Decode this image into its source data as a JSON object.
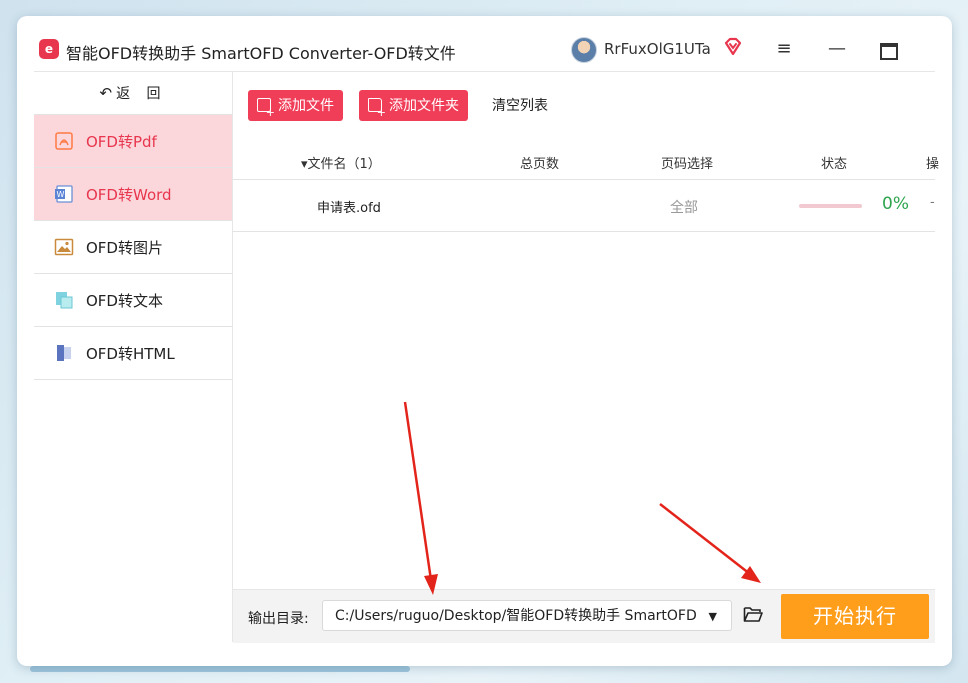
{
  "window": {
    "title": "智能OFD转换助手 SmartOFD Converter-OFD转文件",
    "username": "RrFuxOlG1UTa",
    "logo_text": "e"
  },
  "sidebar": {
    "back_label": "返 回",
    "items": [
      {
        "label": "OFD转Pdf",
        "icon": "pdf-icon",
        "active": true
      },
      {
        "label": "OFD转Word",
        "icon": "word-icon",
        "active": true
      },
      {
        "label": "OFD转图片",
        "icon": "image-icon",
        "active": false
      },
      {
        "label": "OFD转文本",
        "icon": "text-icon",
        "active": false
      },
      {
        "label": "OFD转HTML",
        "icon": "html-icon",
        "active": false
      }
    ]
  },
  "toolbar": {
    "add_file": "添加文件",
    "add_folder": "添加文件夹",
    "clear_list": "清空列表"
  },
  "table": {
    "headers": {
      "filename": "▾文件名（1）",
      "pages": "总页数",
      "page_select": "页码选择",
      "status": "状态",
      "op": "操"
    },
    "rows": [
      {
        "filename": "申请表.ofd",
        "pages": "",
        "page_select": "全部",
        "progress": 0,
        "percent": "0%",
        "op": "-"
      }
    ]
  },
  "footer": {
    "output_label": "输出目录:",
    "output_path": "C:/Users/ruguo/Desktop/智能OFD转换助手 SmartOFD",
    "start_label": "开始执行"
  },
  "colors": {
    "accent": "#f03d58",
    "active_bg": "#fbd7dc",
    "start": "#ff9e1b",
    "success": "#2ea44f",
    "annotation": "#e3241b"
  }
}
